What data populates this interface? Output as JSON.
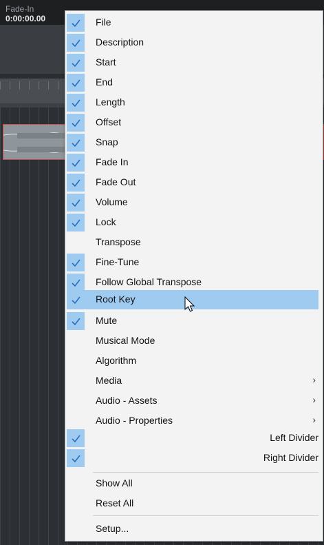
{
  "header": {
    "fade_in_label": "Fade-In",
    "fade_in_value": "0:00:00.00"
  },
  "menu": {
    "items": [
      {
        "label": "File",
        "checked": true
      },
      {
        "label": "Description",
        "checked": true
      },
      {
        "label": "Start",
        "checked": true
      },
      {
        "label": "End",
        "checked": true
      },
      {
        "label": "Length",
        "checked": true
      },
      {
        "label": "Offset",
        "checked": true
      },
      {
        "label": "Snap",
        "checked": true
      },
      {
        "label": "Fade In",
        "checked": true
      },
      {
        "label": "Fade Out",
        "checked": true
      },
      {
        "label": "Volume",
        "checked": true
      },
      {
        "label": "Lock",
        "checked": true
      },
      {
        "label": "Transpose",
        "checked": false
      },
      {
        "label": "Fine-Tune",
        "checked": true
      },
      {
        "label": "Follow Global Transpose",
        "checked": true
      },
      {
        "label": "Root Key",
        "checked": true,
        "highlighted": true
      },
      {
        "label": "Mute",
        "checked": true
      },
      {
        "label": "Musical Mode",
        "checked": false
      },
      {
        "label": "Algorithm",
        "checked": false
      },
      {
        "label": "Media",
        "checked": false,
        "submenu": true
      },
      {
        "label": "Audio - Assets",
        "checked": false,
        "submenu": true
      },
      {
        "label": "Audio - Properties",
        "checked": false,
        "submenu": true
      },
      {
        "label": "Left Divider",
        "checked": true
      },
      {
        "label": "Right Divider",
        "checked": true
      }
    ],
    "actions": {
      "show_all": "Show All",
      "reset_all": "Reset All",
      "setup": "Setup..."
    },
    "submenu_arrow": "›"
  },
  "colors": {
    "check_bg": "#9fcbf1",
    "highlight": "#9fcbf1",
    "clip_border": "#c9494a"
  }
}
